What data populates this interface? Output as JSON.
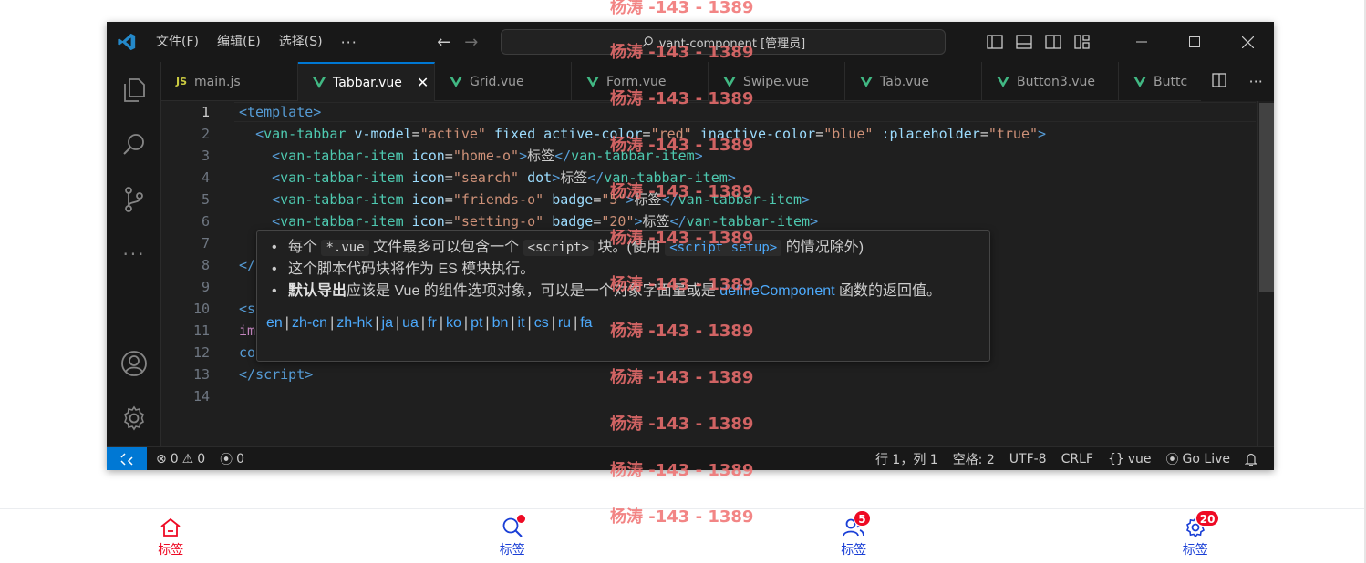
{
  "titlebar": {
    "menu": [
      "文件(F)",
      "编辑(E)",
      "选择(S)"
    ],
    "more": "···",
    "search_text": "vant-component [管理员]"
  },
  "tabs": [
    {
      "label": "main.js",
      "prefix": "JS",
      "active": false
    },
    {
      "label": "Tabbar.vue",
      "active": true
    },
    {
      "label": "Grid.vue",
      "active": false
    },
    {
      "label": "Form.vue",
      "active": false
    },
    {
      "label": "Swipe.vue",
      "active": false
    },
    {
      "label": "Tab.vue",
      "active": false
    },
    {
      "label": "Button3.vue",
      "active": false
    },
    {
      "label": "Buttc",
      "active": false
    }
  ],
  "editor": {
    "line_numbers": [
      "1",
      "2",
      "3",
      "4",
      "5",
      "6",
      "7",
      "8",
      "9",
      "10",
      "11",
      "12",
      "13",
      "14"
    ],
    "lines": {
      "l1": {
        "open": "<",
        "tag": "template",
        "close": ">"
      },
      "l2": {
        "open": "<",
        "tag": "van-tabbar",
        "a1": "v-model",
        "v1": "\"active\"",
        "a2": "fixed",
        "a3": "active-color",
        "v3": "\"red\"",
        "a4": "inactive-color",
        "v4": "\"blue\"",
        "a5": ":placeholder",
        "v5": "\"true\"",
        "close": ">"
      },
      "l3": {
        "tag": "van-tabbar-item",
        "a1": "icon",
        "v1": "\"home-o\"",
        "text": "标签",
        "endtag": "van-tabbar-item"
      },
      "l4": {
        "tag": "van-tabbar-item",
        "a1": "icon",
        "v1": "\"search\"",
        "a2": "dot",
        "text": "标签",
        "endtag": "van-tabbar-item"
      },
      "l5": {
        "tag": "van-tabbar-item",
        "a1": "icon",
        "v1": "\"friends-o\"",
        "a2": "badge",
        "v2": "\"5\"",
        "text": "标签",
        "endtag": "van-tabbar-item"
      },
      "l6": {
        "tag": "van-tabbar-item",
        "a1": "icon",
        "v1": "\"setting-o\"",
        "a2": "badge",
        "v2": "\"20\"",
        "text": "标签",
        "endtag": "van-tabbar-item"
      },
      "l8": "</",
      "l10": "<s",
      "l11": "im",
      "l12": "co",
      "l13": {
        "open": "</",
        "tag": "script",
        "close": ">"
      }
    }
  },
  "hover": {
    "b1_pre": "每个",
    "b1_code1": "*.vue",
    "b1_mid": "文件最多可以包含一个",
    "b1_code2": "<script>",
    "b1_mid2": "块。(使用",
    "b1_code3": "<script setup>",
    "b1_post": "的情况除外)",
    "b2": "这个脚本代码块将作为 ES 模块执行。",
    "b3_bold": "默认导出",
    "b3_text": "应该是 Vue 的组件选项对象，可以是一个对象字面量或是",
    "b3_link": "defineComponent",
    "b3_post": "函数的返回值。",
    "langs": [
      "en",
      "zh-cn",
      "zh-hk",
      "ja",
      "ua",
      "fr",
      "ko",
      "pt",
      "bn",
      "it",
      "cs",
      "ru",
      "fa"
    ]
  },
  "statusbar": {
    "errors": "0",
    "warnings": "0",
    "ports": "0",
    "position": "行 1，列 1",
    "spaces": "空格: 2",
    "encoding": "UTF-8",
    "eol": "CRLF",
    "language": "vue",
    "golive": "Go Live"
  },
  "watermark": "杨涛 -143 - 1389",
  "tabbar": {
    "items": [
      {
        "label": "标签",
        "icon": "home-o",
        "active": true
      },
      {
        "label": "标签",
        "icon": "search",
        "dot": true
      },
      {
        "label": "标签",
        "icon": "friends-o",
        "badge": "5"
      },
      {
        "label": "标签",
        "icon": "setting-o",
        "badge": "20"
      }
    ],
    "active_color": "#ee0a24",
    "inactive_color": "#1a3fd6"
  }
}
